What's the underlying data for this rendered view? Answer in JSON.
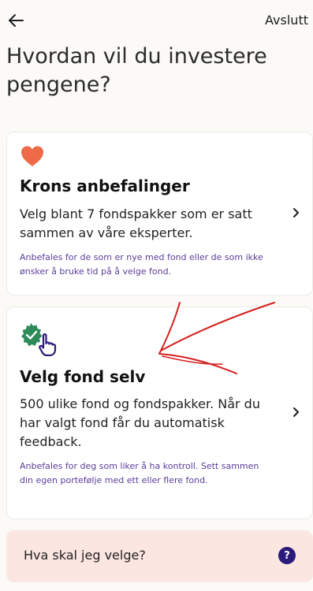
{
  "header": {
    "back_icon": "arrow-left-icon",
    "exit_label": "Avslutt"
  },
  "title": "Hvordan vil du investere pengene?",
  "options": [
    {
      "icon": "heart-icon",
      "title": "Krons anbefalinger",
      "description": "Velg blant 7 fondspakker som er satt sammen av våre eksperter.",
      "note": "Anbefales for de som er nye med fond eller de som ikke ønsker å bruke tid på å velge fond."
    },
    {
      "icon": "badge-check-hand-icon",
      "title": "Velg fond selv",
      "description": "500 ulike fond og fondspakker. Når du har valgt fond får du automatisk feedback.",
      "note": "Anbefales for deg som liker å ha kontroll. Sett sammen din egen portefølje med ett eller flere fond."
    }
  ],
  "help": {
    "label": "Hva skal jeg velge?",
    "icon_text": "?"
  },
  "colors": {
    "heart": "#ef6b48",
    "badge": "#2f8b5a",
    "note_text": "#5a3d9a",
    "help_bg": "#fbe6e1",
    "help_icon_bg": "#2a1a7a",
    "annotation_arrow": "#d42020"
  }
}
